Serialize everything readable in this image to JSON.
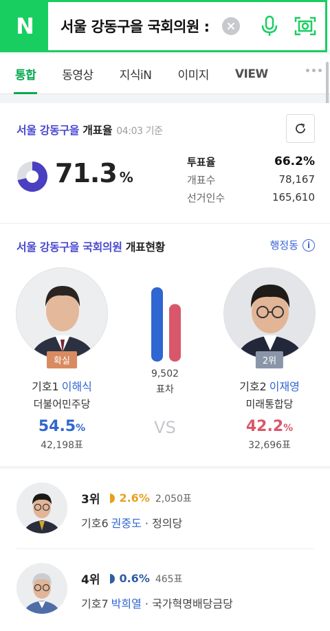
{
  "search": {
    "logo": "N",
    "query": "서울 강동구을 국회의원 :"
  },
  "tabs": [
    "통합",
    "동영상",
    "지식iN",
    "이미지",
    "VIEW"
  ],
  "turnout_card": {
    "title_region": "서울 강동구을",
    "title_suffix": "개표율",
    "time": "04:03 기준",
    "count_rate": "71.3",
    "count_rate_unit": "%",
    "count_rate_value": 71.3,
    "stats": [
      {
        "label": "투표율",
        "value": "66.2%"
      },
      {
        "label": "개표수",
        "value": "78,167"
      },
      {
        "label": "선거인수",
        "value": "165,610"
      }
    ]
  },
  "status_card": {
    "title_region": "서울 강동구을 국회의원",
    "title_suffix": "개표현황",
    "admin_link": "행정동",
    "gap_votes": "9,502",
    "gap_label": "표차",
    "vs": "VS",
    "colors": {
      "blue": "#2f66d2",
      "red": "#d9576a"
    },
    "candidates": [
      {
        "badge": "확실",
        "number": "기호1",
        "name": "이해식",
        "party": "더불어민주당",
        "pct": "54.5",
        "pct_unit": "%",
        "pct_value": 54.5,
        "votes": "42,198표"
      },
      {
        "badge": "2위",
        "number": "기호2",
        "name": "이재영",
        "party": "미래통합당",
        "pct": "42.2",
        "pct_unit": "%",
        "pct_value": 42.2,
        "votes": "32,696표"
      }
    ]
  },
  "others": [
    {
      "rank": "3위",
      "pct": "2.6%",
      "pct_value": 2.6,
      "pct_color": "#e8a020",
      "votes": "2,050표",
      "number": "기호6",
      "name": "권중도",
      "party": "· 정의당"
    },
    {
      "rank": "4위",
      "pct": "0.6%",
      "pct_value": 0.6,
      "pct_color": "#2f5da6",
      "votes": "465표",
      "number": "기호7",
      "name": "박희열",
      "party": "· 국가혁명배당금당"
    }
  ]
}
